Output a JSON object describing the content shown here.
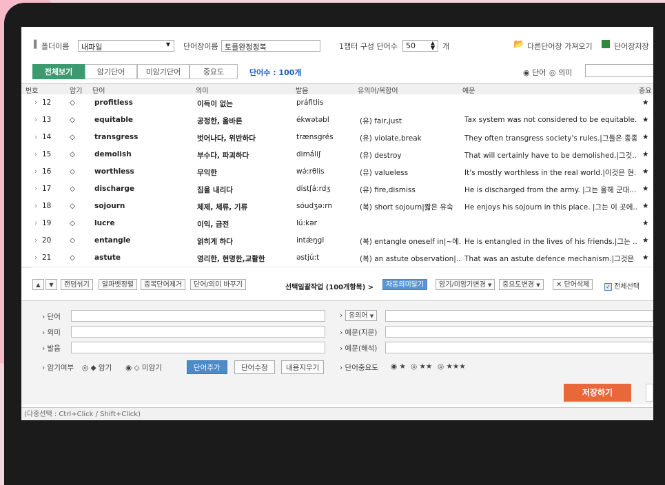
{
  "top": {
    "folder_label": "폴더이름",
    "folder_value": "내파일",
    "wordbook_label": "단어장이름",
    "wordbook_value": "토플완정정복",
    "chapter_label": "1챕터 구성 단어수",
    "chapter_value": "50",
    "chapter_unit": "개",
    "import_label": "다른단어장 가져오기",
    "save_label": "단어장저장"
  },
  "tabs": [
    "전체보기",
    "암기단어",
    "미암기단어",
    "중요도"
  ],
  "word_count": "단어수 : 100개",
  "search_mode": {
    "word": "단어",
    "meaning": "의미",
    "selected": "word"
  },
  "columns": {
    "no": "번호",
    "memorized": "암기",
    "word": "단어",
    "meaning": "의미",
    "pron": "발음",
    "synonym": "유의어/복합어",
    "example": "예문",
    "importance": "중요"
  },
  "rows": [
    {
      "no": "12",
      "mem": "◇",
      "word": "profitless",
      "meaning": "이득이 없는",
      "pron": "práfitlis",
      "syn": "",
      "ex": "",
      "star": "★"
    },
    {
      "no": "13",
      "mem": "◇",
      "word": "equitable",
      "meaning": "공정한, 올바른",
      "pron": "ékwətəbl",
      "syn": "(유) fair,just",
      "ex": "Tax system was not considered to be equitable.|...",
      "star": "★"
    },
    {
      "no": "14",
      "mem": "◇",
      "word": "transgress",
      "meaning": "벗어나다, 위반하다",
      "pron": "trænsgrés",
      "syn": "(유) violate,break",
      "ex": "They often transgress society's rules.|그들은 종종...",
      "star": "★"
    },
    {
      "no": "15",
      "mem": "◇",
      "word": "demolish",
      "meaning": "부수다, 파괴하다",
      "pron": "dimáliʃ",
      "syn": "(유) destroy",
      "ex": "That will certainly have to be demolished.|그것...",
      "star": "★"
    },
    {
      "no": "16",
      "mem": "◇",
      "word": "worthless",
      "meaning": "무익한",
      "pron": "wə́:rθlis",
      "syn": "(유) valueless",
      "ex": "It's mostly worthless in the real world.|이것은 현...",
      "star": "★"
    },
    {
      "no": "17",
      "mem": "◇",
      "word": "discharge",
      "meaning": "짐을 내리다",
      "pron": "distʃá:rdʒ",
      "syn": "(유) fire,dismiss",
      "ex": "He is discharged from the army. |그는 올해 군대...",
      "star": "★"
    },
    {
      "no": "18",
      "mem": "◇",
      "word": "sojourn",
      "meaning": "체제, 체류, 기류",
      "pron": "sóudʒə:rn",
      "syn": "(복) short sojourn|짧은 유숙",
      "ex": "He enjoys his sojourn in this place. |그는 이 곳에...",
      "star": "★"
    },
    {
      "no": "19",
      "mem": "◇",
      "word": "lucre",
      "meaning": "이익, 금전",
      "pron": "lú:kər",
      "syn": "",
      "ex": "",
      "star": "★"
    },
    {
      "no": "20",
      "mem": "◇",
      "word": "entangle",
      "meaning": "얽히게 하다",
      "pron": "intǽŋgl",
      "syn": "(복) entangle oneself in|~에...",
      "ex": "He is entangled in the lives of his friends.|그는 ...",
      "star": "★"
    },
    {
      "no": "21",
      "mem": "◇",
      "word": "astute",
      "meaning": "영리한, 현명한,교활한",
      "pron": "əstjú:t",
      "syn": "(복) an astute observation|...",
      "ex": "That was an astute defence mechanism.|그것은 ...",
      "star": "★"
    }
  ],
  "toolbar": {
    "up": "▲",
    "down": "▼",
    "shuffle": "랜덤섞기",
    "alpha": "알파벳정렬",
    "dedupe": "중복단어제거",
    "swap": "단어/의미 바꾸기",
    "batch_label": "선택일괄작업 (100개항목) >",
    "auto_meaning": "자동의미달기",
    "mem_change": "암기/미암기변경",
    "imp_change": "중요도변경",
    "delete": "단어삭제",
    "select_all": "전체선택"
  },
  "form": {
    "word": "단어",
    "meaning": "의미",
    "pron": "발음",
    "synonym": "유의어",
    "example": "예문(지문)",
    "example_trans": "예문(해석)",
    "mem_label": "암기여부",
    "mem_yes": "◆ 암기",
    "mem_no": "◇ 미암기",
    "add": "단어추가",
    "edit": "단어수정",
    "clear": "내용지우기",
    "importance_label": "단어중요도",
    "imp1": "★",
    "imp2": "★★",
    "imp3": "★★★"
  },
  "save_button": "저장하기",
  "status": "(다중선택 : Ctrl+Click / Shift+Click)"
}
